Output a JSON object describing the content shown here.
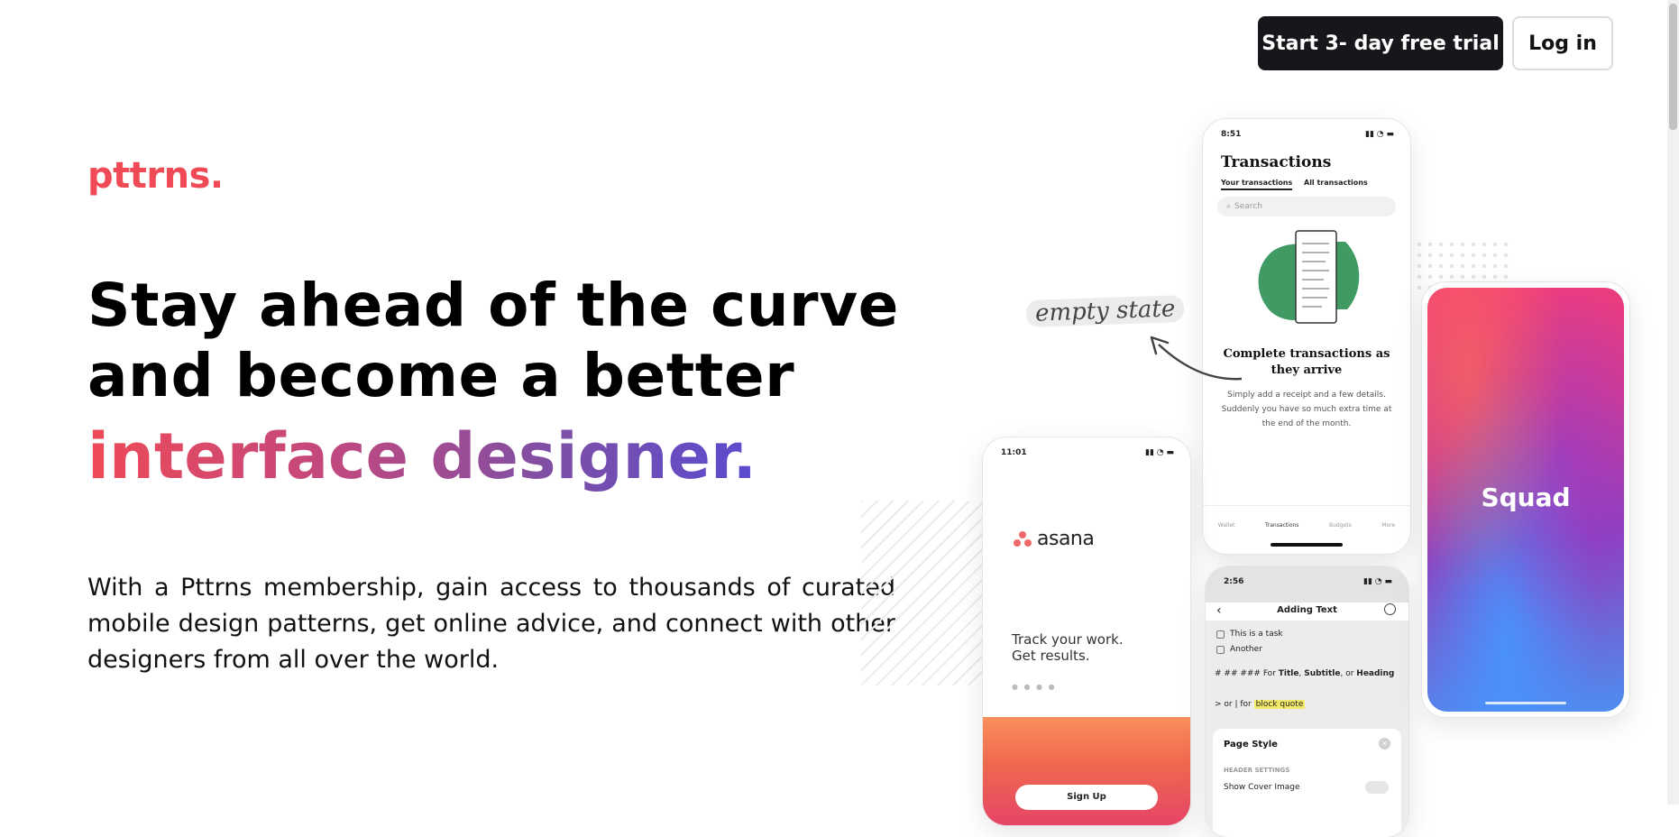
{
  "header": {
    "trial_button": "Start 3- day free trial",
    "login_button": "Log in"
  },
  "brand": {
    "logo": "pttrns."
  },
  "hero": {
    "headline_line1": "Stay ahead of the curve",
    "headline_line2": "and become a better",
    "headline_gradient": "interface designer.",
    "description": "With a Pttrns membership, gain access to thousands of curated mobile design patterns, get online advice, and connect with other designers from all over the world."
  },
  "showcase": {
    "callout": "empty state",
    "transactions": {
      "time": "8:51",
      "title": "Transactions",
      "tab_active": "Your transactions",
      "tab_other": "All transactions",
      "search_placeholder": "Search",
      "heading": "Complete transactions as they arrive",
      "body": "Simply add a receipt and a few details. Suddenly you have so much extra time at the end of the month.",
      "tabbar": [
        "Wallet",
        "Transactions",
        "Budgets",
        "More"
      ]
    },
    "asana": {
      "time": "11:01",
      "brand": "asana",
      "tagline_line1": "Track your work.",
      "tagline_line2": "Get results.",
      "pager": "● ● ● ●",
      "signup": "Sign Up"
    },
    "adding_text": {
      "time": "2:56",
      "title": "Adding Text",
      "task1": "This is a task",
      "task2": "Another",
      "hint1_prefix": "# ## ### For",
      "hint1_bold1": "Title",
      "hint1_sep": ",",
      "hint1_bold2": "Subtitle",
      "hint1_or": ", or",
      "hint1_bold3": "Heading",
      "hint2_prefix": "> or | for",
      "hint2_highlight": "block quote",
      "sheet_title": "Page Style",
      "sheet_section": "HEADER SETTINGS",
      "sheet_row": "Show Cover Image"
    },
    "squad": {
      "title": "Squad"
    }
  }
}
